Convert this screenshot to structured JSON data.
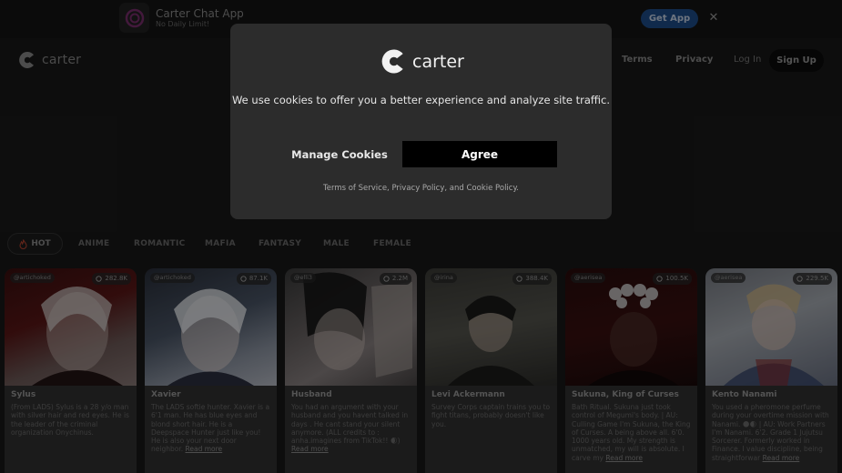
{
  "banner": {
    "title": "Carter Chat App",
    "subtitle": "No Daily Limit!",
    "get_app": "Get App",
    "close": "✕"
  },
  "header": {
    "logo_text": "carter",
    "terms": "Terms",
    "privacy": "Privacy",
    "login": "Log In",
    "signup": "Sign Up"
  },
  "filters": {
    "hot": "HOT",
    "items": [
      "ANIME",
      "ROMANTIC",
      "MAFIA",
      "FANTASY",
      "MALE",
      "FEMALE"
    ]
  },
  "cards": [
    {
      "handle": "@artichoked",
      "count": "282.8K",
      "name": "Sylus",
      "desc": "(From LADS) Sylus is a 28 y/o man with silver hair and red eyes. He is the leader of the criminal organization Onychinus.",
      "read_more": ""
    },
    {
      "handle": "@artichoked",
      "count": "87.1K",
      "name": "Xavier",
      "desc": "The LADS softie hunter. Xavier is a 6'1 man. He has blue eyes and blond short hair. He is a Deepspace Hunter just like you! He is also your next door neighbor.",
      "read_more": "Read more"
    },
    {
      "handle": "@elli3",
      "count": "2.2M",
      "name": "Husband",
      "desc": "You had an argument with your husband and you havent talked in days . He cant stand your silent anymore. (ALL credits to : anha.imagines from TikTok!! 🌒)",
      "read_more": "Read more"
    },
    {
      "handle": "@irina",
      "count": "388.4K",
      "name": "Levi Ackermann",
      "desc": "Survey Corps captain trains you to fight titans, probably doesn't like you.",
      "read_more": ""
    },
    {
      "handle": "@aerisea",
      "count": "100.5K",
      "name": "Sukuna, King of Curses",
      "desc": "Bath Ritual. Sukuna just took control of Megumi's body. | AU: Culling Game I'm Sukuna, the King of Curses. A being above all. 6'0. 1000 years old. My strength is unmatched, my will is absolute. I carve my",
      "read_more": "Read more"
    },
    {
      "handle": "@aerisea",
      "count": "229.5K",
      "name": "Kento Nanami",
      "desc": "You used a pheromone perfume during your overtime mission with Nanami. 🌑🌒 | AU: Work Partners I'm Nanami. 6'2. Grade 1 Jujutsu Sorcerer. Formerly worked in Finance. I value discipline, being straightforwar",
      "read_more": "Read more"
    }
  ],
  "modal": {
    "logo_text": "carter",
    "message": "We use cookies to offer you a better experience and analyze site traffic.",
    "manage": "Manage Cookies",
    "agree": "Agree",
    "tos": "Terms of Service",
    "sep1": ", ",
    "pp": "Privacy Policy",
    "sep2": ", and ",
    "cp": "Cookie Policy",
    "end": "."
  },
  "colors": {
    "background": "#191919",
    "modal": "#2c2c2c",
    "agree_button": "#000000",
    "get_app": "#1e4d8a",
    "hot_flame": "#e0482c"
  }
}
